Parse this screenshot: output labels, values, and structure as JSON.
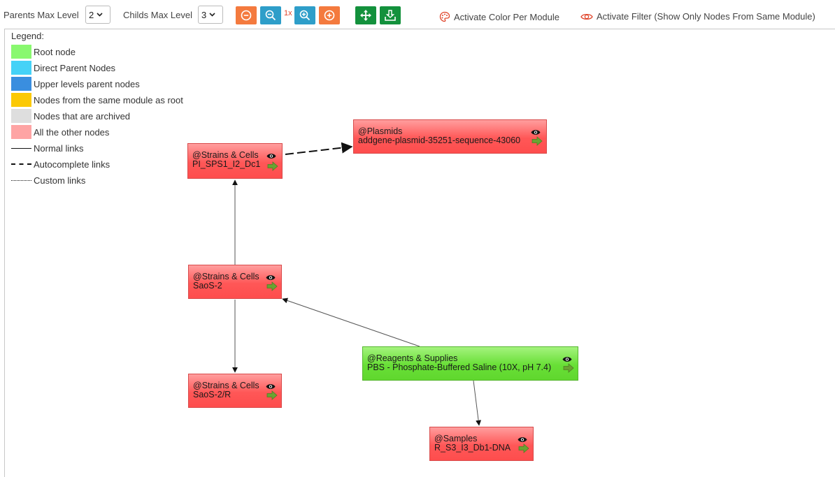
{
  "toolbar": {
    "parents_label": "Parents Max Level",
    "parents_value": "2",
    "childs_label": "Childs Max Level",
    "childs_value": "3",
    "zoom_level": "1x",
    "color_toggle": "Activate Color Per Module",
    "filter_toggle": "Activate Filter (Show Only Nodes From Same Module)",
    "icons": [
      "minus-circle-icon",
      "zoom-out-icon",
      "zoom-in-icon",
      "plus-circle-icon",
      "move-arrows-icon",
      "export-icon",
      "palette-icon",
      "eye-icon"
    ],
    "colors": {
      "orange": "#f47a3e",
      "blue": "#2e9ec9",
      "green": "#13913c"
    }
  },
  "legend": {
    "title": "Legend:",
    "items": [
      {
        "label": "Root node",
        "color": "#89f86f"
      },
      {
        "label": "Direct Parent Nodes",
        "color": "#45d2f7"
      },
      {
        "label": "Upper levels parent nodes",
        "color": "#3a8edf"
      },
      {
        "label": "Nodes from the same module as root",
        "color": "#fbc905"
      },
      {
        "label": "Nodes that are archived",
        "color": "#dedede"
      },
      {
        "label": "All the other nodes",
        "color": "#fea4a4"
      }
    ],
    "links": [
      {
        "label": "Normal links",
        "style": "solid"
      },
      {
        "label": "Autocomplete links",
        "style": "dashed"
      },
      {
        "label": "Custom links",
        "style": "dotted"
      }
    ]
  },
  "nodes": [
    {
      "id": "n1",
      "module": "@Strains & Cells",
      "name": "PI_SPS1_I2_Dc1",
      "type": "other"
    },
    {
      "id": "n2",
      "module": "@Plasmids",
      "name": "addgene-plasmid-35251-sequence-43060",
      "type": "other"
    },
    {
      "id": "n3",
      "module": "@Strains & Cells",
      "name": "SaoS-2",
      "type": "other"
    },
    {
      "id": "n4",
      "module": "@Reagents & Supplies",
      "name": "PBS - Phosphate-Buffered Saline (10X, pH 7.4)",
      "type": "root"
    },
    {
      "id": "n5",
      "module": "@Strains & Cells",
      "name": "SaoS-2/R",
      "type": "other"
    },
    {
      "id": "n6",
      "module": "@Samples",
      "name": "R_S3_I3_Db1-DNA",
      "type": "other"
    }
  ],
  "edges": [
    {
      "from": "n1",
      "to": "n2",
      "style": "dashed"
    },
    {
      "from": "n3",
      "to": "n1",
      "style": "solid"
    },
    {
      "from": "n4",
      "to": "n3",
      "style": "solid"
    },
    {
      "from": "n3",
      "to": "n5",
      "style": "solid"
    },
    {
      "from": "n4",
      "to": "n6",
      "style": "solid"
    }
  ]
}
